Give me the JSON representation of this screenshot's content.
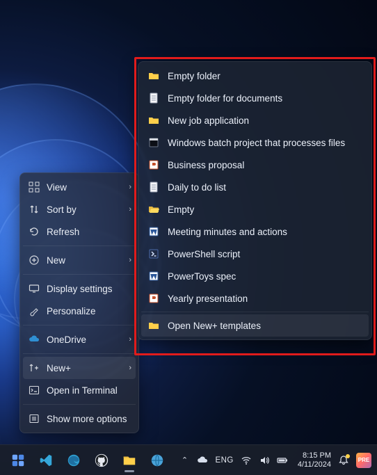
{
  "context_menu": {
    "items": [
      {
        "label": "View",
        "icon": "grid-icon",
        "arrow": true
      },
      {
        "label": "Sort by",
        "icon": "sort-icon",
        "arrow": true
      },
      {
        "label": "Refresh",
        "icon": "refresh-icon",
        "arrow": false
      },
      {
        "sep": true
      },
      {
        "label": "New",
        "icon": "plus-icon",
        "arrow": true
      },
      {
        "sep": true
      },
      {
        "label": "Display settings",
        "icon": "display-icon",
        "arrow": false
      },
      {
        "label": "Personalize",
        "icon": "brush-icon",
        "arrow": false
      },
      {
        "sep": true
      },
      {
        "label": "OneDrive",
        "icon": "cloud-icon",
        "arrow": true
      },
      {
        "sep": true
      },
      {
        "label": "New+",
        "icon": "newplus-icon",
        "arrow": true,
        "selected": true
      },
      {
        "label": "Open in Terminal",
        "icon": "terminal-icon",
        "arrow": false
      },
      {
        "sep": true
      },
      {
        "label": "Show more options",
        "icon": "more-icon",
        "arrow": false
      }
    ]
  },
  "submenu": {
    "items": [
      {
        "label": "Empty folder",
        "icon": "folder-icon"
      },
      {
        "label": "Empty folder for documents",
        "icon": "document-icon"
      },
      {
        "label": "New job application",
        "icon": "folder-icon"
      },
      {
        "label": "Windows batch project that processes files",
        "icon": "batch-icon"
      },
      {
        "label": "Business proposal",
        "icon": "powerpoint-icon"
      },
      {
        "label": "Daily to do list",
        "icon": "document-icon"
      },
      {
        "label": "Empty",
        "icon": "folder-open-icon"
      },
      {
        "label": "Meeting minutes and actions",
        "icon": "word-icon"
      },
      {
        "label": "PowerShell script",
        "icon": "powershell-icon"
      },
      {
        "label": "PowerToys spec",
        "icon": "word-icon"
      },
      {
        "label": "Yearly presentation",
        "icon": "powerpoint-icon"
      },
      {
        "sep": true
      },
      {
        "label": "Open New+ templates",
        "icon": "folder-icon",
        "selected": true
      }
    ]
  },
  "taskbar": {
    "apps": [
      {
        "name": "widgets-app",
        "color": "#7aa7ff"
      },
      {
        "name": "vscode-app",
        "color": "#35a7d9"
      },
      {
        "name": "edge-app",
        "color": "#2f9fd0"
      },
      {
        "name": "github-app",
        "color": "#e6e9f0"
      },
      {
        "name": "explorer-app",
        "color": "#ffcf4a",
        "active": true
      },
      {
        "name": "browser-app",
        "color": "#4aa3d9"
      }
    ],
    "tray_chevron": "⌃",
    "lang": "ENG",
    "time": "8:15 PM",
    "date": "4/11/2024",
    "badge": "PRE"
  }
}
